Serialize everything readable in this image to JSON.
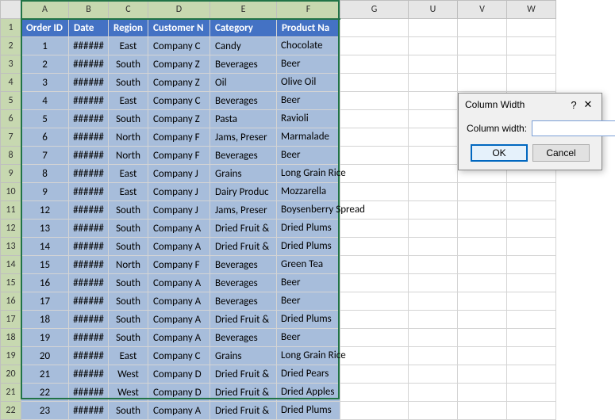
{
  "columns": [
    "A",
    "B",
    "C",
    "D",
    "E",
    "F",
    "G",
    "U",
    "V",
    "W"
  ],
  "selectedCols": [
    "A",
    "B",
    "C",
    "D",
    "E",
    "F"
  ],
  "headers": {
    "A": "Order ID",
    "B": "Date",
    "C": "Region",
    "D": "Customer N",
    "E": "Category",
    "F": "Product Na"
  },
  "chart_data": {
    "type": "table",
    "columns": [
      "Order ID",
      "Date",
      "Region",
      "Customer N",
      "Category",
      "Product Na"
    ],
    "rows": [
      {
        "Order ID": 1,
        "Date": "######",
        "Region": "East",
        "Customer N": "Company C",
        "Category": "Candy",
        "Product Na": "Chocolate"
      },
      {
        "Order ID": 2,
        "Date": "######",
        "Region": "South",
        "Customer N": "Company Z",
        "Category": "Beverages",
        "Product Na": "Beer"
      },
      {
        "Order ID": 3,
        "Date": "######",
        "Region": "South",
        "Customer N": "Company Z",
        "Category": "Oil",
        "Product Na": "Olive Oil"
      },
      {
        "Order ID": 4,
        "Date": "######",
        "Region": "East",
        "Customer N": "Company C",
        "Category": "Beverages",
        "Product Na": "Beer"
      },
      {
        "Order ID": 5,
        "Date": "######",
        "Region": "South",
        "Customer N": "Company Z",
        "Category": "Pasta",
        "Product Na": "Ravioli"
      },
      {
        "Order ID": 6,
        "Date": "######",
        "Region": "North",
        "Customer N": "Company F",
        "Category": "Jams, Preser",
        "Product Na": "Marmalade"
      },
      {
        "Order ID": 7,
        "Date": "######",
        "Region": "North",
        "Customer N": "Company F",
        "Category": "Beverages",
        "Product Na": "Beer"
      },
      {
        "Order ID": 8,
        "Date": "######",
        "Region": "East",
        "Customer N": "Company J",
        "Category": "Grains",
        "Product Na": "Long Grain Rice"
      },
      {
        "Order ID": 9,
        "Date": "######",
        "Region": "East",
        "Customer N": "Company J",
        "Category": "Dairy Produc",
        "Product Na": "Mozzarella"
      },
      {
        "Order ID": 12,
        "Date": "######",
        "Region": "South",
        "Customer N": "Company J",
        "Category": "Jams, Preser",
        "Product Na": "Boysenberry Spread"
      },
      {
        "Order ID": 13,
        "Date": "######",
        "Region": "South",
        "Customer N": "Company A",
        "Category": "Dried Fruit &",
        "Product Na": "Dried Plums"
      },
      {
        "Order ID": 14,
        "Date": "######",
        "Region": "South",
        "Customer N": "Company A",
        "Category": "Dried Fruit &",
        "Product Na": "Dried Plums"
      },
      {
        "Order ID": 15,
        "Date": "######",
        "Region": "North",
        "Customer N": "Company F",
        "Category": "Beverages",
        "Product Na": "Green Tea"
      },
      {
        "Order ID": 16,
        "Date": "######",
        "Region": "South",
        "Customer N": "Company A",
        "Category": "Beverages",
        "Product Na": "Beer"
      },
      {
        "Order ID": 17,
        "Date": "######",
        "Region": "South",
        "Customer N": "Company A",
        "Category": "Beverages",
        "Product Na": "Beer"
      },
      {
        "Order ID": 18,
        "Date": "######",
        "Region": "South",
        "Customer N": "Company A",
        "Category": "Dried Fruit &",
        "Product Na": "Dried Plums"
      },
      {
        "Order ID": 19,
        "Date": "######",
        "Region": "South",
        "Customer N": "Company A",
        "Category": "Beverages",
        "Product Na": "Beer"
      },
      {
        "Order ID": 20,
        "Date": "######",
        "Region": "East",
        "Customer N": "Company C",
        "Category": "Grains",
        "Product Na": "Long Grain Rice"
      },
      {
        "Order ID": 21,
        "Date": "######",
        "Region": "West",
        "Customer N": "Company D",
        "Category": "Dried Fruit &",
        "Product Na": "Dried Pears"
      },
      {
        "Order ID": 22,
        "Date": "######",
        "Region": "West",
        "Customer N": "Company D",
        "Category": "Dried Fruit &",
        "Product Na": "Dried Apples"
      },
      {
        "Order ID": 23,
        "Date": "######",
        "Region": "South",
        "Customer N": "Company A",
        "Category": "Dried Fruit &",
        "Product Na": "Dried Plums"
      }
    ]
  },
  "dialog": {
    "title": "Column Width",
    "label": "Column width:",
    "value": "",
    "ok": "OK",
    "cancel": "Cancel"
  }
}
